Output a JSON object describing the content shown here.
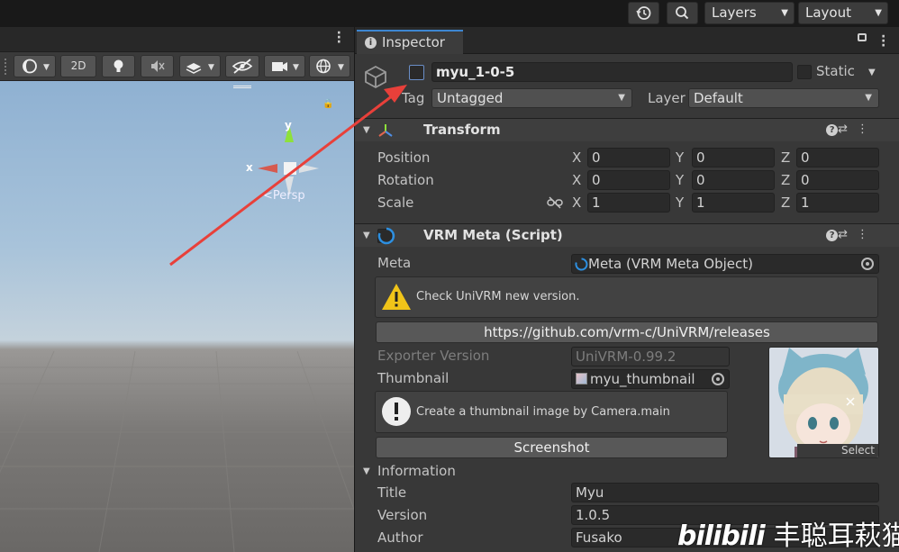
{
  "topbar": {
    "history_icon": "history-icon",
    "search_icon": "search-icon",
    "layers_label": "Layers",
    "layout_label": "Layout"
  },
  "scene": {
    "toolbar": {
      "mode_2d_label": "2D"
    },
    "gizmo": {
      "y_label": "y",
      "x_label": "x",
      "persp_label": "<Persp"
    }
  },
  "inspector": {
    "tab_label": "Inspector",
    "object": {
      "name": "myu_1-0-5",
      "static_label": "Static",
      "tag_label": "Tag",
      "tag_value": "Untagged",
      "layer_label": "Layer",
      "layer_value": "Default"
    },
    "transform": {
      "title": "Transform",
      "rows": [
        {
          "label": "Position",
          "x": "0",
          "y": "0",
          "z": "0"
        },
        {
          "label": "Rotation",
          "x": "0",
          "y": "0",
          "z": "0"
        },
        {
          "label": "Scale",
          "x": "1",
          "y": "1",
          "z": "1"
        }
      ],
      "axis_x": "X",
      "axis_y": "Y",
      "axis_z": "Z"
    },
    "vrm_meta": {
      "title": "VRM Meta (Script)",
      "meta_label": "Meta",
      "meta_value": "Meta (VRM Meta Object)",
      "warning_text": "Check UniVRM new version.",
      "release_link": "https://github.com/vrm-c/UniVRM/releases",
      "exporter_label": "Exporter Version",
      "exporter_value": "UniVRM-0.99.2",
      "thumbnail_label": "Thumbnail",
      "thumbnail_value": "myu_thumbnail",
      "thumbnail_select": "Select",
      "info_box_text": "Create a thumbnail image by Camera.main",
      "screenshot_button": "Screenshot",
      "information_label": "Information",
      "fields": [
        {
          "label": "Title",
          "value": "Myu"
        },
        {
          "label": "Version",
          "value": "1.0.5"
        },
        {
          "label": "Author",
          "value": "Fusako"
        }
      ]
    }
  },
  "watermark": {
    "brand": "bilibili",
    "author": "丰聪耳萩猫"
  },
  "colors": {
    "accent_blue": "#3d86d1",
    "annotation_arrow": "#e8403a",
    "panel_bg": "#383838"
  }
}
